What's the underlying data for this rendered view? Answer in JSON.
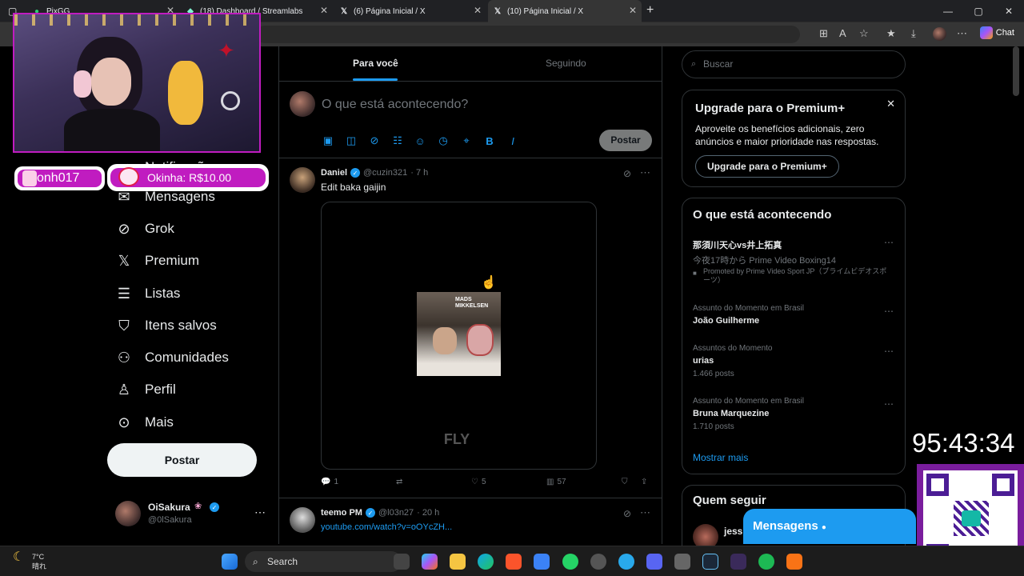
{
  "browser": {
    "tabs": [
      {
        "title": "PixGG"
      },
      {
        "title": "(18) Dashboard / Streamlabs"
      },
      {
        "title": "(6) Página Inicial / X"
      },
      {
        "title": "(10) Página Inicial / X"
      }
    ],
    "chat_label": "Chat"
  },
  "nav": {
    "items": [
      {
        "label": "Notificações",
        "icon": "bell-icon"
      },
      {
        "label": "Mensagens",
        "icon": "mail-icon"
      },
      {
        "label": "Grok",
        "icon": "grok-icon"
      },
      {
        "label": "Premium",
        "icon": "x-logo-icon"
      },
      {
        "label": "Listas",
        "icon": "list-icon"
      },
      {
        "label": "Itens salvos",
        "icon": "bookmark-icon"
      },
      {
        "label": "Comunidades",
        "icon": "people-icon"
      },
      {
        "label": "Perfil",
        "icon": "person-icon"
      },
      {
        "label": "Mais",
        "icon": "more-circle-icon"
      }
    ],
    "post_label": "Postar",
    "profile": {
      "name": "OiSakura",
      "handle": "@0lSakura"
    }
  },
  "timeline": {
    "tabs": [
      "Para você",
      "Seguindo"
    ],
    "composer_placeholder": "O que está acontecendo?",
    "post_button": "Postar",
    "tweets": [
      {
        "author": "Daniel",
        "handle": "@cuzin321",
        "time": "· 7 h",
        "text": "Edit baka gaijin",
        "media_caption": "FLY",
        "media_banner": "MADS MIKKELSEN",
        "replies": "1",
        "retweets": "",
        "likes": "5",
        "views": "57"
      },
      {
        "author": "teemo PM",
        "handle": "@l03n27",
        "time": "· 20 h",
        "text": "youtube.com/watch?v=oOYcZH..."
      }
    ]
  },
  "sidebar": {
    "search_placeholder": "Buscar",
    "premium": {
      "title": "Upgrade para o Premium+",
      "body": "Aproveite os benefícios adicionais, zero anúncios e maior prioridade nas respostas.",
      "button": "Upgrade para o Premium+"
    },
    "trends_title": "O que está acontecendo",
    "trends": [
      {
        "name": "那須川天心vs井上拓真",
        "sub": "今夜17時から Prime Video Boxing14",
        "promo": "Promoted by Prime Video Sport JP（プライムビデオスポーツ）"
      },
      {
        "category": "Assunto do Momento em Brasil",
        "name": "João Guilherme"
      },
      {
        "category": "Assuntos do Momento",
        "name": "urias",
        "posts": "1.466 posts"
      },
      {
        "category": "Assunto do Momento em Brasil",
        "name": "Bruna Marquezine",
        "posts": "1.710 posts"
      }
    ],
    "show_more": "Mostrar mais",
    "who_to_follow": "Quem seguir",
    "follow_name": "jessi"
  },
  "overlay": {
    "donor_left": "onh017",
    "donor_right": "Okinha: R$10.00",
    "timer": "95:43:34",
    "messages_bar": "Mensagens"
  },
  "taskbar": {
    "search": "Search",
    "weather_temp": "7°C",
    "weather_desc": "晴れ"
  },
  "colors": {
    "accent": "#1d9bf0",
    "overlay_magenta": "#c01cc0"
  }
}
